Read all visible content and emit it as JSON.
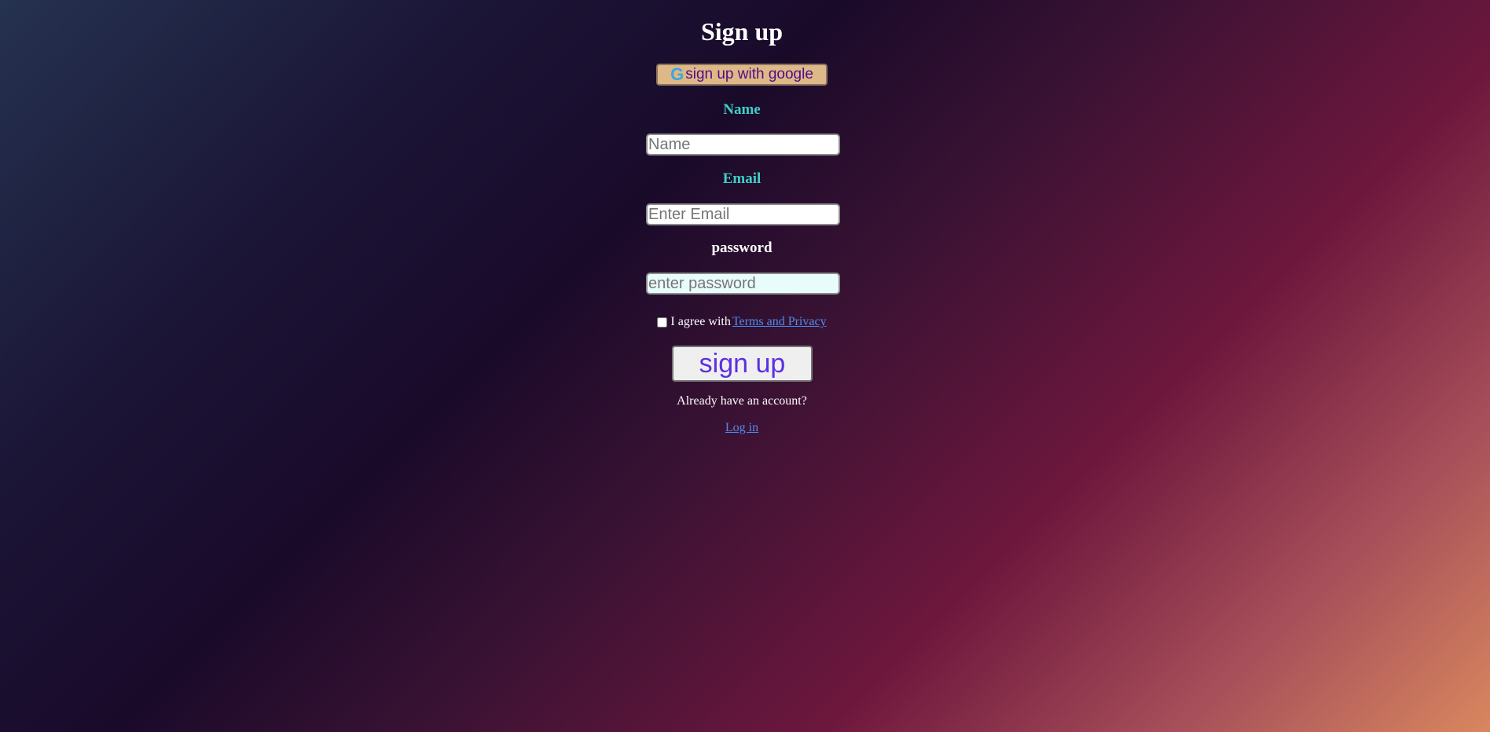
{
  "page": {
    "title": "Sign up"
  },
  "google_button": {
    "icon_name": "google-icon",
    "icon_glyph": "G",
    "label": "sign up with google"
  },
  "fields": {
    "name": {
      "label": "Name",
      "placeholder": "Name",
      "value": ""
    },
    "email": {
      "label": "Email",
      "placeholder": "Enter Email",
      "value": ""
    },
    "password": {
      "label": "password",
      "placeholder": "enter password",
      "value": ""
    }
  },
  "agreement": {
    "text": "I agree with",
    "link_text": "Terms and Privacy",
    "checked": false
  },
  "submit_button": {
    "label": "sign up"
  },
  "footer": {
    "prompt": "Already have an account?",
    "login_link": "Log in"
  },
  "colors": {
    "label_teal": "#3ed0c8",
    "google_button_bg": "#deb887",
    "google_button_text": "#4b0e8a",
    "submit_text": "#5b2fe0",
    "link": "#4f8cf0"
  }
}
